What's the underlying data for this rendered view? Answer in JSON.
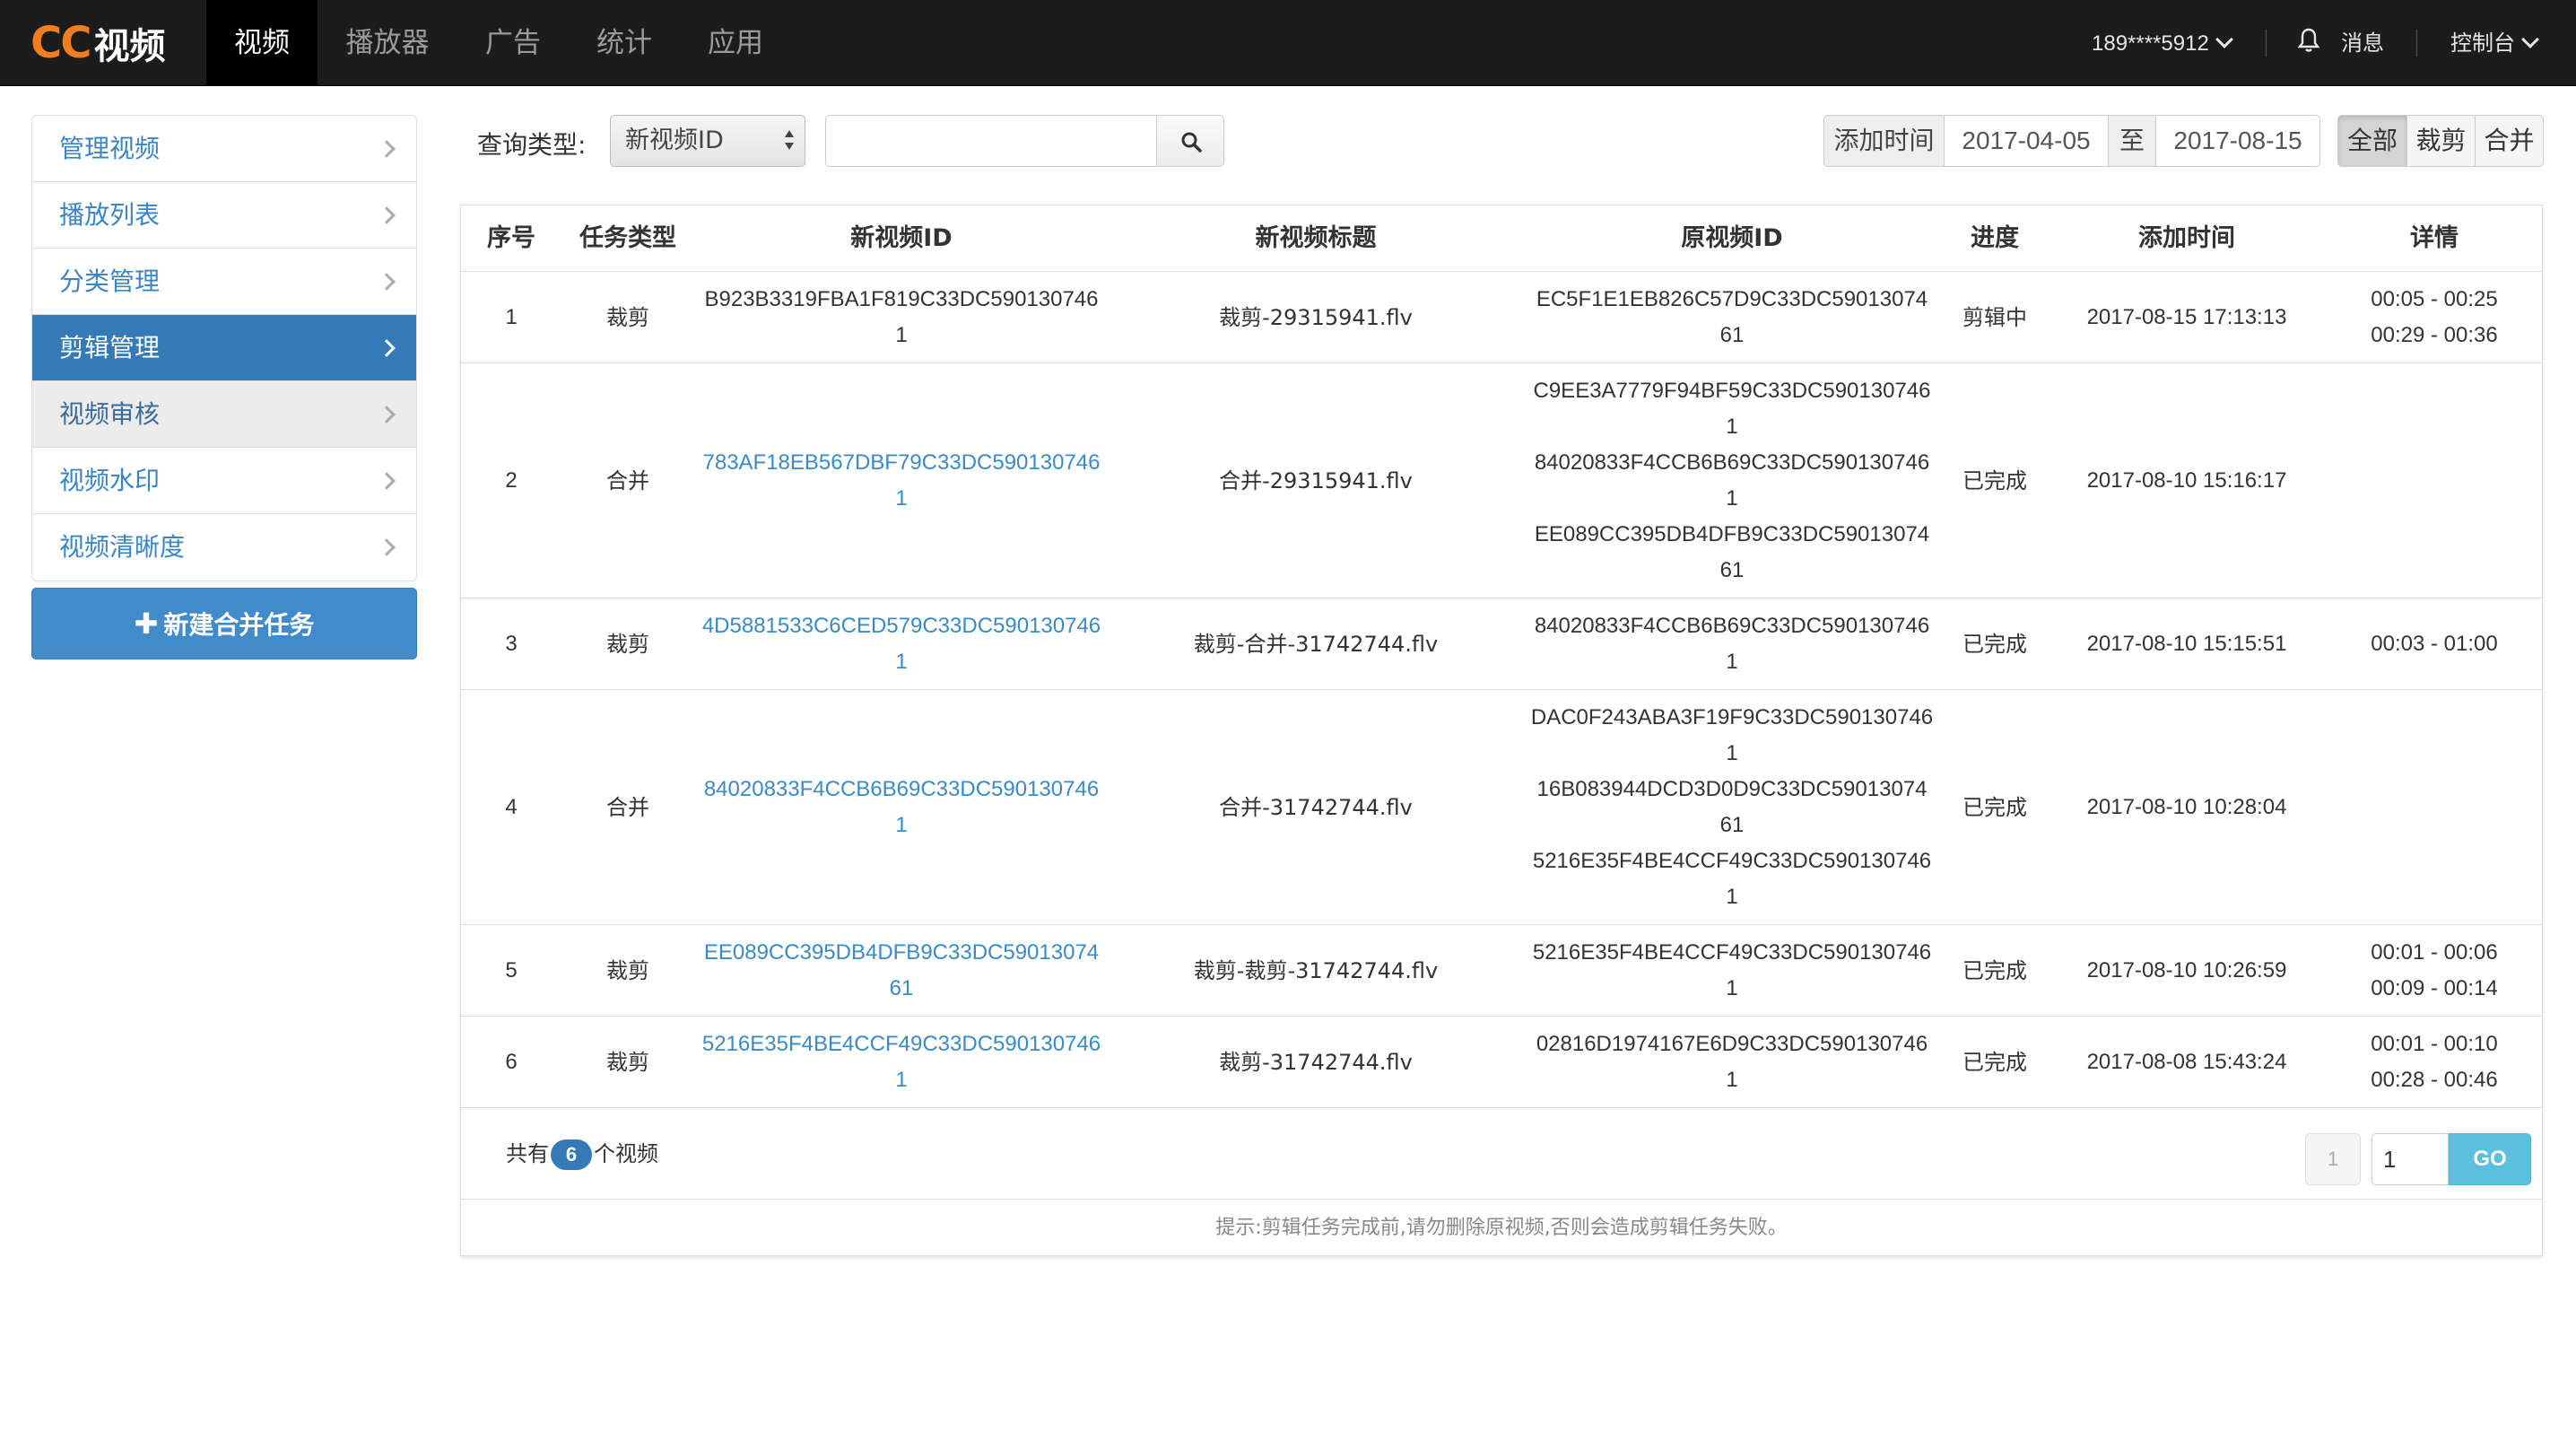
{
  "header": {
    "logo_cc": "CC",
    "logo_text": "视频",
    "nav": [
      {
        "label": "视频",
        "active": true
      },
      {
        "label": "播放器",
        "active": false
      },
      {
        "label": "广告",
        "active": false
      },
      {
        "label": "统计",
        "active": false
      },
      {
        "label": "应用",
        "active": false
      }
    ],
    "user": "189****5912",
    "messages": "消息",
    "console": "控制台",
    "bell_icon": "bell-icon"
  },
  "sidebar": {
    "items": [
      {
        "label": "管理视频"
      },
      {
        "label": "播放列表"
      },
      {
        "label": "分类管理"
      },
      {
        "label": "剪辑管理",
        "active": true
      },
      {
        "label": "视频审核",
        "hover": true
      },
      {
        "label": "视频水印"
      },
      {
        "label": "视频清晰度"
      }
    ],
    "new_button": "新建合并任务",
    "new_button_icon": "plus-icon"
  },
  "query": {
    "label": "查询类型:",
    "select_value": "新视频ID",
    "search_value": "",
    "search_icon": "search-icon",
    "date_label": "添加时间",
    "date_from": "2017-04-05",
    "date_sep": "至",
    "date_to": "2017-08-15",
    "filters": [
      {
        "label": "全部",
        "active": true
      },
      {
        "label": "裁剪",
        "active": false
      },
      {
        "label": "合并",
        "active": false
      }
    ]
  },
  "table": {
    "headers": [
      "序号",
      "任务类型",
      "新视频ID",
      "新视频标题",
      "原视频ID",
      "进度",
      "添加时间",
      "详情"
    ],
    "rows": [
      {
        "no": "1",
        "type": "裁剪",
        "new_id": [
          "B923B3319FBA1F819C33DC590130746",
          "1"
        ],
        "new_id_link": false,
        "title": "裁剪-29315941.flv",
        "orig_ids": [
          "EC5F1E1EB826C57D9C33DC59013074",
          "61"
        ],
        "progress": "剪辑中",
        "added": "2017-08-15 17:13:13",
        "details": [
          "00:05 - 00:25",
          "00:29 - 00:36"
        ]
      },
      {
        "no": "2",
        "type": "合并",
        "new_id": [
          "783AF18EB567DBF79C33DC590130746",
          "1"
        ],
        "new_id_link": true,
        "title": "合并-29315941.flv",
        "orig_ids": [
          "C9EE3A7779F94BF59C33DC590130746",
          "1",
          "84020833F4CCB6B69C33DC590130746",
          "1",
          "EE089CC395DB4DFB9C33DC59013074",
          "61"
        ],
        "progress": "已完成",
        "added": "2017-08-10 15:16:17",
        "details": []
      },
      {
        "no": "3",
        "type": "裁剪",
        "new_id": [
          "4D5881533C6CED579C33DC590130746",
          "1"
        ],
        "new_id_link": true,
        "title": "裁剪-合并-31742744.flv",
        "orig_ids": [
          "84020833F4CCB6B69C33DC590130746",
          "1"
        ],
        "progress": "已完成",
        "added": "2017-08-10 15:15:51",
        "details": [
          "00:03 - 01:00"
        ]
      },
      {
        "no": "4",
        "type": "合并",
        "new_id": [
          "84020833F4CCB6B69C33DC590130746",
          "1"
        ],
        "new_id_link": true,
        "title": "合并-31742744.flv",
        "orig_ids": [
          "DAC0F243ABA3F19F9C33DC590130746",
          "1",
          "16B083944DCD3D0D9C33DC59013074",
          "61",
          "5216E35F4BE4CCF49C33DC590130746",
          "1"
        ],
        "progress": "已完成",
        "added": "2017-08-10 10:28:04",
        "details": []
      },
      {
        "no": "5",
        "type": "裁剪",
        "new_id": [
          "EE089CC395DB4DFB9C33DC59013074",
          "61"
        ],
        "new_id_link": true,
        "title": "裁剪-裁剪-31742744.flv",
        "orig_ids": [
          "5216E35F4BE4CCF49C33DC590130746",
          "1"
        ],
        "progress": "已完成",
        "added": "2017-08-10 10:26:59",
        "details": [
          "00:01 - 00:06",
          "00:09 - 00:14"
        ]
      },
      {
        "no": "6",
        "type": "裁剪",
        "new_id": [
          "5216E35F4BE4CCF49C33DC590130746",
          "1"
        ],
        "new_id_link": true,
        "title": "裁剪-31742744.flv",
        "orig_ids": [
          "02816D1974167E6D9C33DC590130746",
          "1"
        ],
        "progress": "已完成",
        "added": "2017-08-08 15:43:24",
        "details": [
          "00:01 - 00:10",
          "00:28 - 00:46"
        ]
      }
    ]
  },
  "footer": {
    "total_prefix": "共有",
    "total_count": "6",
    "total_suffix": "个视频",
    "page_current": "1",
    "page_input": "1",
    "go_label": "GO",
    "hint": "提示:剪辑任务完成前,请勿删除原视频,否则会造成剪辑任务失败。"
  }
}
